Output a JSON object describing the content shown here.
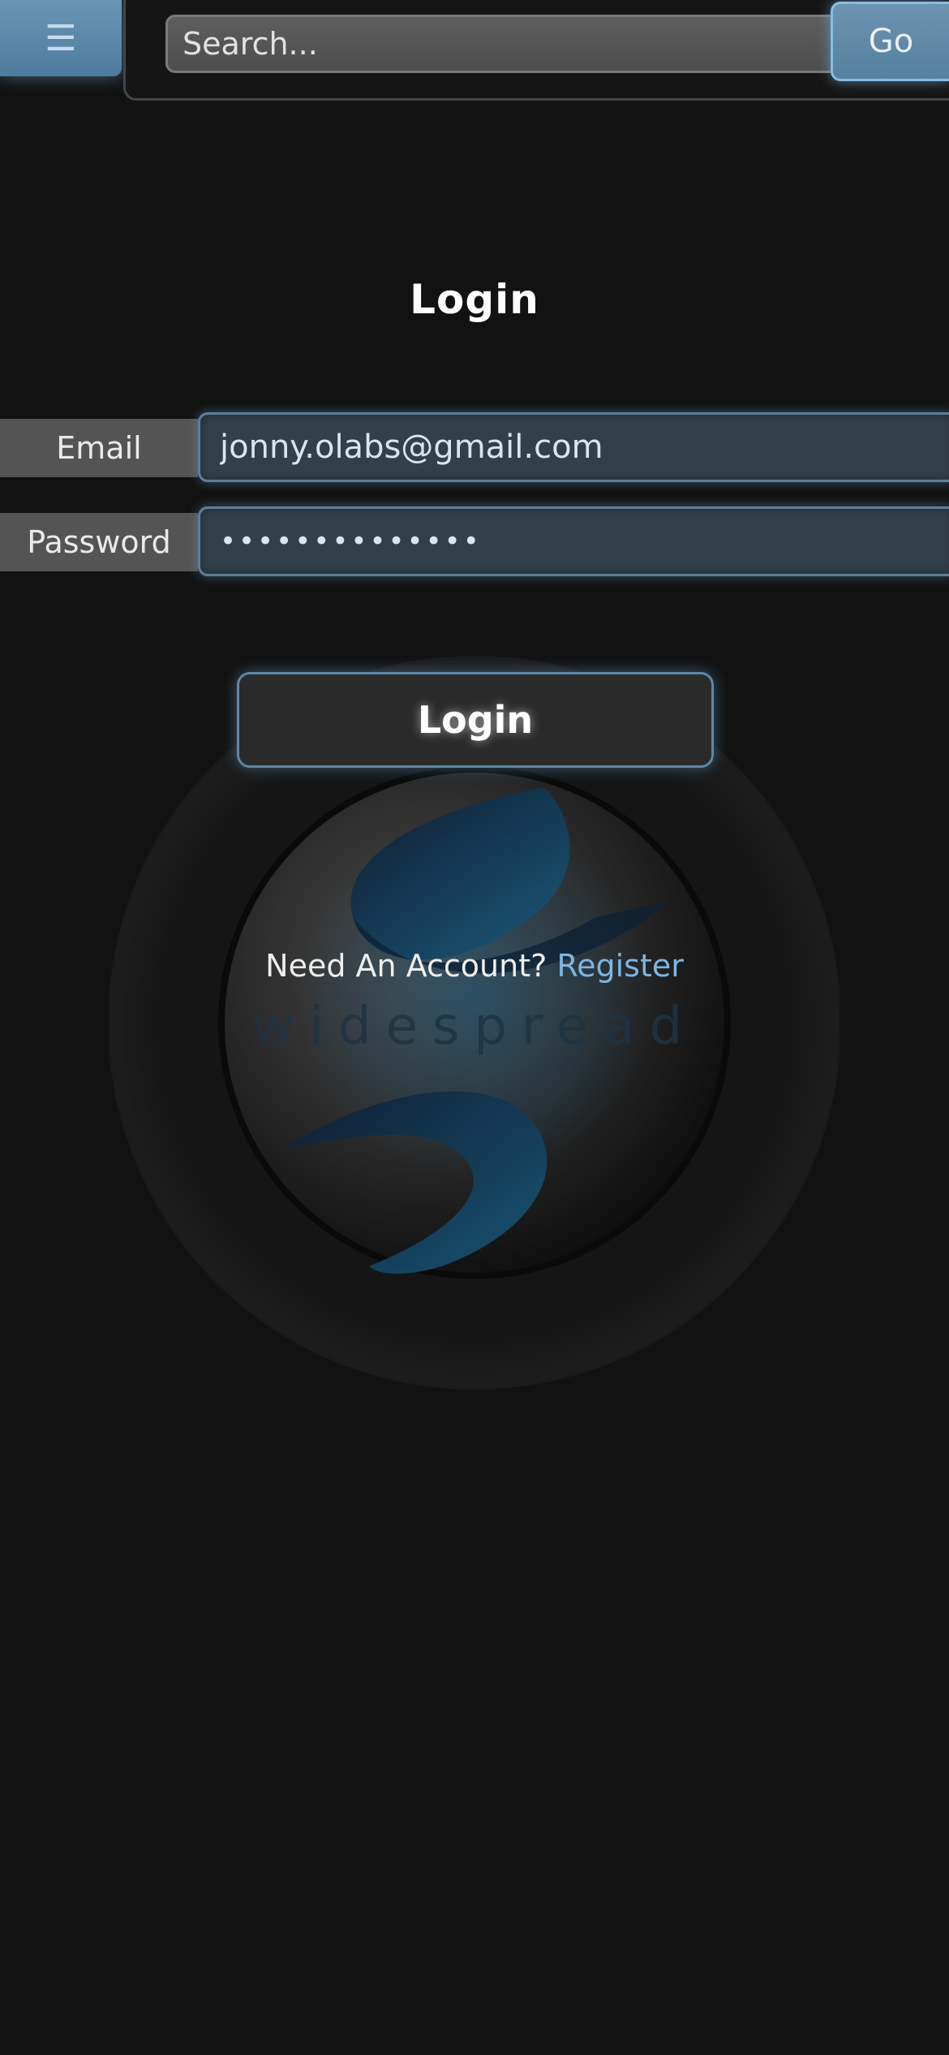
{
  "header": {
    "menu_icon": "☰",
    "search_placeholder": "Search...",
    "go_label": "Go"
  },
  "logo": {
    "wordmark": "widespread"
  },
  "page": {
    "title": "Login"
  },
  "form": {
    "email_label": "Email",
    "email_value": "jonny.olabs@gmail.com",
    "password_label": "Password",
    "password_value": "••••••••••••••",
    "submit_label": "Login"
  },
  "register": {
    "prompt": "Need An Account?",
    "link_label": "Register"
  },
  "colors": {
    "background": "#121212",
    "accent": "#7fb4e0",
    "input_background": "#32404a"
  }
}
